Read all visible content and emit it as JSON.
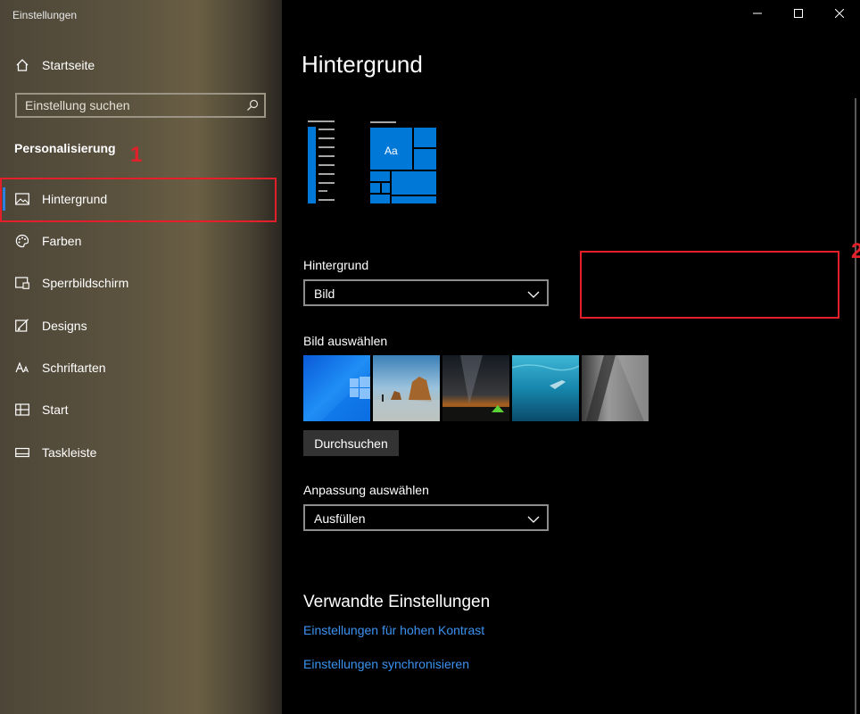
{
  "window": {
    "title": "Einstellungen",
    "minimize_icon": "minimize-icon",
    "maximize_icon": "maximize-icon",
    "close_icon": "close-icon"
  },
  "sidebar": {
    "home_label": "Startseite",
    "search_placeholder": "Einstellung suchen",
    "section_title": "Personalisierung",
    "items": [
      {
        "label": "Hintergrund",
        "icon": "image-icon",
        "active": true
      },
      {
        "label": "Farben",
        "icon": "palette-icon"
      },
      {
        "label": "Sperrbildschirm",
        "icon": "lock-screen-icon"
      },
      {
        "label": "Designs",
        "icon": "designs-icon"
      },
      {
        "label": "Schriftarten",
        "icon": "fonts-icon"
      },
      {
        "label": "Start",
        "icon": "start-icon"
      },
      {
        "label": "Taskleiste",
        "icon": "taskbar-icon"
      }
    ]
  },
  "annotations": {
    "one": "1",
    "two": "2",
    "color": "#e3202a"
  },
  "main": {
    "title": "Hintergrund",
    "preview_text": "Aa",
    "background_label": "Hintergrund",
    "background_value": "Bild",
    "choose_image_label": "Bild auswählen",
    "browse_label": "Durchsuchen",
    "fit_label": "Anpassung auswählen",
    "fit_value": "Ausfüllen",
    "related_title": "Verwandte Einstellungen",
    "links": [
      "Einstellungen für hohen Kontrast",
      "Einstellungen synchronisieren"
    ]
  },
  "colors": {
    "accent": "#0078d7",
    "link": "#3a93f0"
  }
}
